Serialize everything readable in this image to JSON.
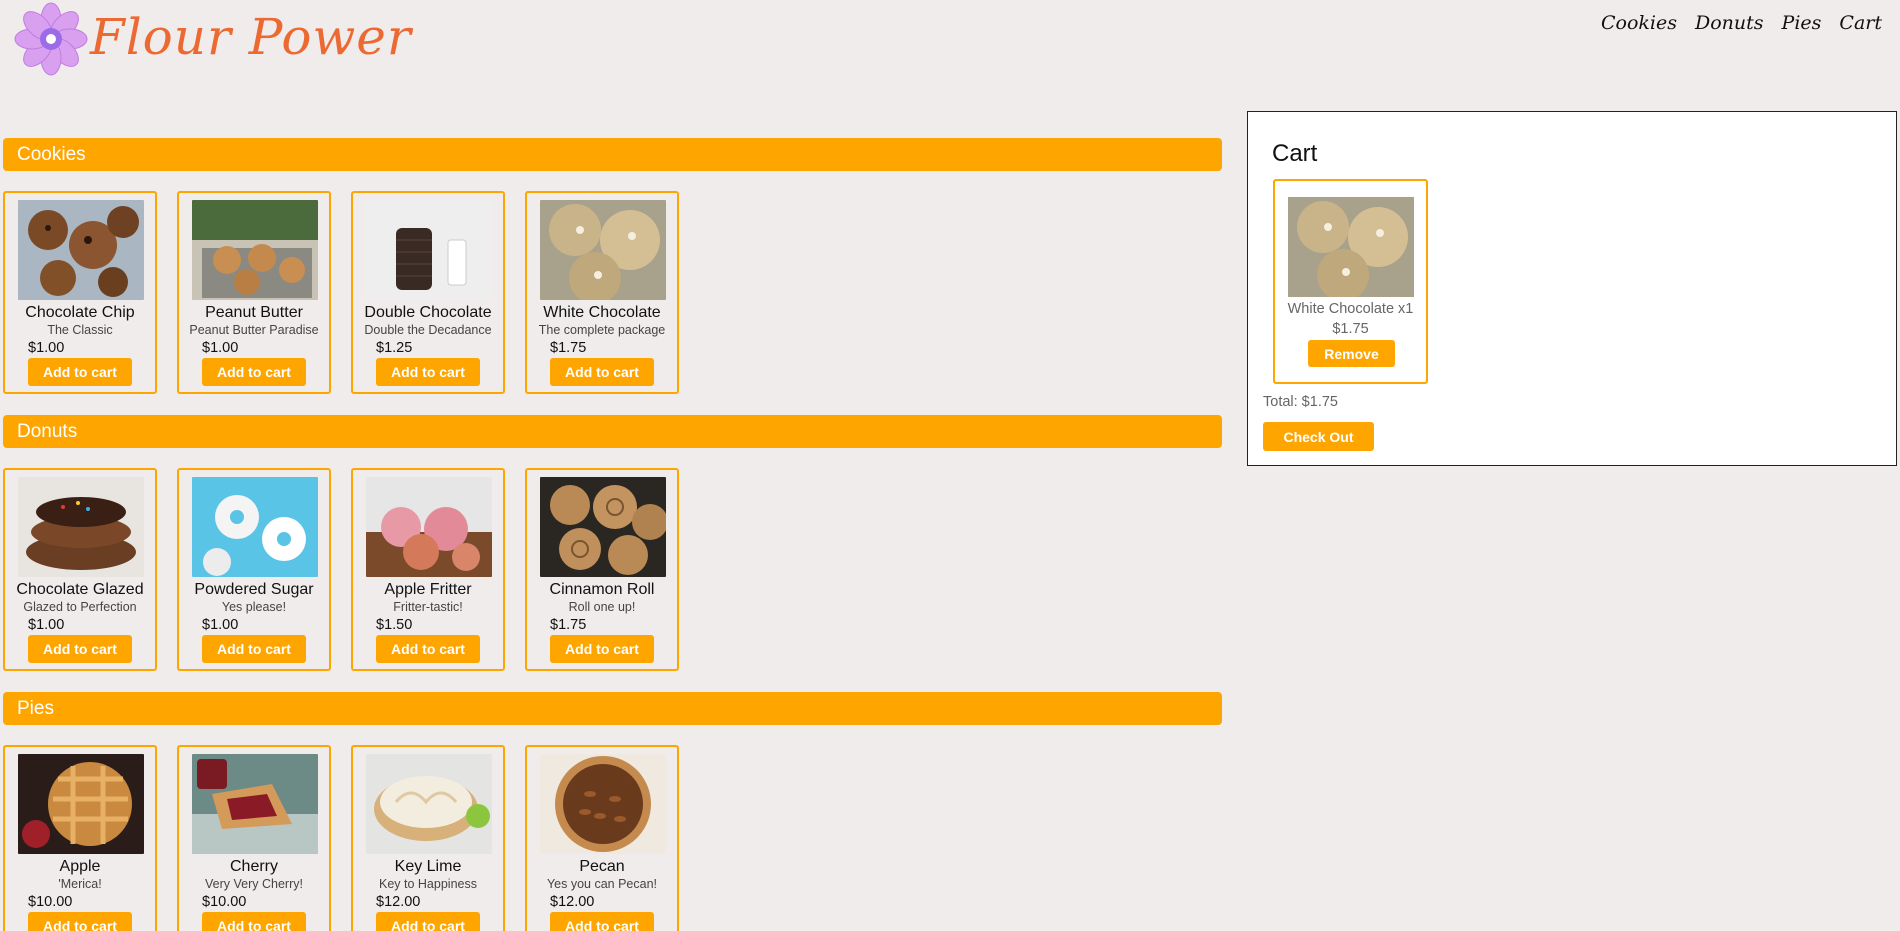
{
  "brand": {
    "name": "Flour Power"
  },
  "nav": {
    "items": [
      "Cookies",
      "Donuts",
      "Pies",
      "Cart"
    ]
  },
  "sections": [
    {
      "title": "Cookies",
      "items": [
        {
          "name": "Chocolate Chip",
          "desc": "The Classic",
          "price": "$1.00",
          "button": "Add to cart"
        },
        {
          "name": "Peanut Butter",
          "desc": "Peanut Butter Paradise",
          "price": "$1.00",
          "button": "Add to cart"
        },
        {
          "name": "Double Chocolate",
          "desc": "Double the Decadance",
          "price": "$1.25",
          "button": "Add to cart"
        },
        {
          "name": "White Chocolate",
          "desc": "The complete package",
          "price": "$1.75",
          "button": "Add to cart"
        }
      ]
    },
    {
      "title": "Donuts",
      "items": [
        {
          "name": "Chocolate Glazed",
          "desc": "Glazed to Perfection",
          "price": "$1.00",
          "button": "Add to cart"
        },
        {
          "name": "Powdered Sugar",
          "desc": "Yes please!",
          "price": "$1.00",
          "button": "Add to cart"
        },
        {
          "name": "Apple Fritter",
          "desc": "Fritter-tastic!",
          "price": "$1.50",
          "button": "Add to cart"
        },
        {
          "name": "Cinnamon Roll",
          "desc": "Roll one up!",
          "price": "$1.75",
          "button": "Add to cart"
        }
      ]
    },
    {
      "title": "Pies",
      "items": [
        {
          "name": "Apple",
          "desc": "'Merica!",
          "price": "$10.00",
          "button": "Add to cart"
        },
        {
          "name": "Cherry",
          "desc": "Very Very Cherry!",
          "price": "$10.00",
          "button": "Add to cart"
        },
        {
          "name": "Key Lime",
          "desc": "Key to Happiness",
          "price": "$12.00",
          "button": "Add to cart"
        },
        {
          "name": "Pecan",
          "desc": "Yes you can Pecan!",
          "price": "$12.00",
          "button": "Add to cart"
        }
      ]
    }
  ],
  "cart": {
    "title": "Cart",
    "item": {
      "label": "White Chocolate x1",
      "price": "$1.75",
      "remove": "Remove"
    },
    "total": "Total: $1.75",
    "checkout": "Check Out"
  },
  "colors": {
    "accent": "#ffa500",
    "brand": "#ec6a32",
    "background": "#f0ecec"
  }
}
